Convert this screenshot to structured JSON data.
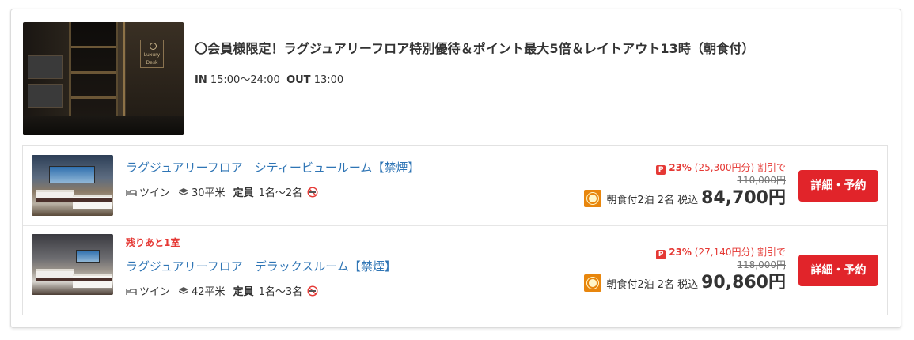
{
  "plan": {
    "title": "〇会員様限定！ラグジュアリーフロア特別優待＆ポイント最大5倍＆レイトアウト13時（朝食付）",
    "checkin_label": "IN",
    "checkin_time": "15:00〜24:00",
    "checkout_label": "OUT",
    "checkout_time": "13:00",
    "photo_sign_text": "Luxury Desk"
  },
  "rooms": [
    {
      "alert": "",
      "name": "ラグジュアリーフロア　シティービュールーム【禁煙】",
      "bed": "ツイン",
      "size": "30平米",
      "capacity_label": "定員",
      "capacity": "1名〜2名",
      "discount_pct": "23%",
      "discount_amount": "(25,300円分)",
      "discount_suffix": "割引で",
      "original_price": "110,000円",
      "meal_info": "朝食付2泊 2名",
      "tax_label": "税込",
      "price": "84,700円",
      "button": "詳細・予約"
    },
    {
      "alert": "残りあと1室",
      "name": "ラグジュアリーフロア　デラックスルーム【禁煙】",
      "bed": "ツイン",
      "size": "42平米",
      "capacity_label": "定員",
      "capacity": "1名〜3名",
      "discount_pct": "23%",
      "discount_amount": "(27,140円分)",
      "discount_suffix": "割引で",
      "original_price": "118,000円",
      "meal_info": "朝食付2泊 2名",
      "tax_label": "税込",
      "price": "90,860円",
      "button": "詳細・予約"
    }
  ],
  "icons": {
    "bed": "bed-icon",
    "size": "cube-icon",
    "no_smoking": "no-smoking-icon",
    "discount": "point-badge-icon",
    "meal": "sun-meal-icon"
  },
  "colors": {
    "accent_red": "#e1242a",
    "link_blue": "#2f75b5",
    "meal_orange": "#e8860d"
  }
}
